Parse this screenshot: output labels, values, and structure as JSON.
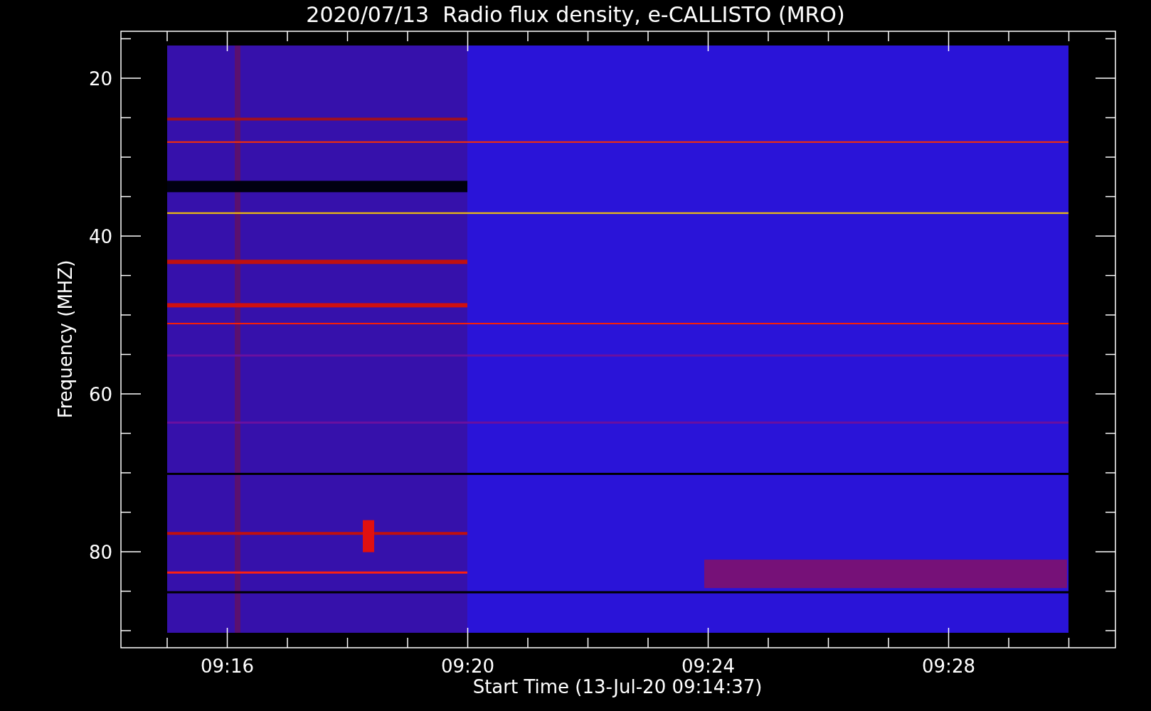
{
  "title": "2020/07/13  Radio flux density, e-CALLISTO (MRO)",
  "y_axis": {
    "label": "Frequency (MHZ)",
    "ticks": [
      "20",
      "40",
      "60",
      "80"
    ]
  },
  "x_axis": {
    "label": "Start Time (13-Jul-20 09:14:37)",
    "ticks": [
      "09:16",
      "09:20",
      "09:24",
      "09:28"
    ]
  },
  "plot": {
    "kind": "spectrogram"
  }
}
